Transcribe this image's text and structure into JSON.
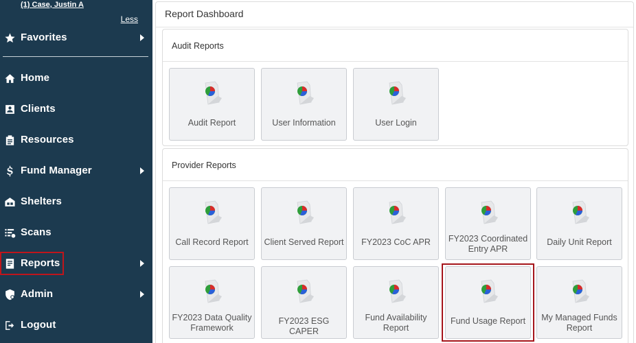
{
  "sidebar": {
    "user_link": "(1) Case, Justin A",
    "less_link": "Less",
    "favorites": "Favorites",
    "items": [
      {
        "label": "Home",
        "icon": "home-icon",
        "arrow": false
      },
      {
        "label": "Clients",
        "icon": "id-card-icon",
        "arrow": false
      },
      {
        "label": "Resources",
        "icon": "clipboard-icon",
        "arrow": false
      },
      {
        "label": "Fund Manager",
        "icon": "dollar-icon",
        "arrow": true
      },
      {
        "label": "Shelters",
        "icon": "shelter-icon",
        "arrow": false
      },
      {
        "label": "Scans",
        "icon": "scan-list-icon",
        "arrow": false
      },
      {
        "label": "Reports",
        "icon": "report-icon",
        "arrow": true,
        "selected": true
      },
      {
        "label": "Admin",
        "icon": "admin-shield-icon",
        "arrow": true
      },
      {
        "label": "Logout",
        "icon": "logout-icon",
        "arrow": false
      }
    ]
  },
  "main": {
    "title": "Report Dashboard",
    "audit_section": {
      "title": "Audit Reports",
      "tiles": [
        "Audit Report",
        "User Information",
        "User Login"
      ]
    },
    "provider_section": {
      "title": "Provider Reports",
      "tiles": [
        "Call Record Report",
        "Client Served Report",
        "FY2023 CoC APR",
        "FY2023 Coordinated Entry APR",
        "Daily Unit Report",
        "FY2023 Data Quality Framework",
        "FY2023 ESG CAPER",
        "Fund Availability Report",
        "Fund Usage Report",
        "My Managed Funds Report"
      ],
      "highlighted": "Fund Usage Report"
    }
  },
  "colors": {
    "sidebar_bg": "#1c3a4f",
    "highlight": "#a5141a",
    "tile_bg": "#f1f2f4"
  }
}
